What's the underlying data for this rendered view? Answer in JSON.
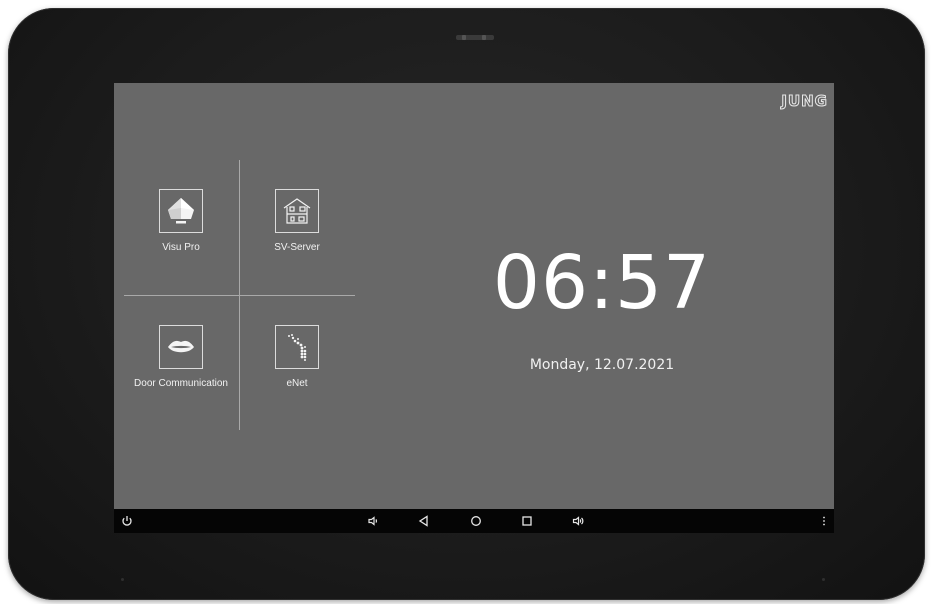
{
  "device": {
    "brand_logo": "JUNG"
  },
  "apps": [
    {
      "label": "Visu Pro",
      "icon": "visu-pro-icon"
    },
    {
      "label": "SV-Server",
      "icon": "sv-server-icon"
    },
    {
      "label": "Door Communication",
      "icon": "door-communication-icon"
    },
    {
      "label": "eNet",
      "icon": "enet-icon"
    }
  ],
  "clock": {
    "time": "06:57",
    "date": "Monday, 12.07.2021"
  },
  "navbar": {
    "buttons": [
      "power-icon",
      "volume-down-icon",
      "back-icon",
      "home-icon",
      "recents-icon",
      "volume-up-icon",
      "menu-icon"
    ]
  },
  "colors": {
    "screen_bg": "#686868",
    "navbar_bg": "#050505",
    "bezel": "#1c1c1c",
    "text": "#ffffff"
  }
}
